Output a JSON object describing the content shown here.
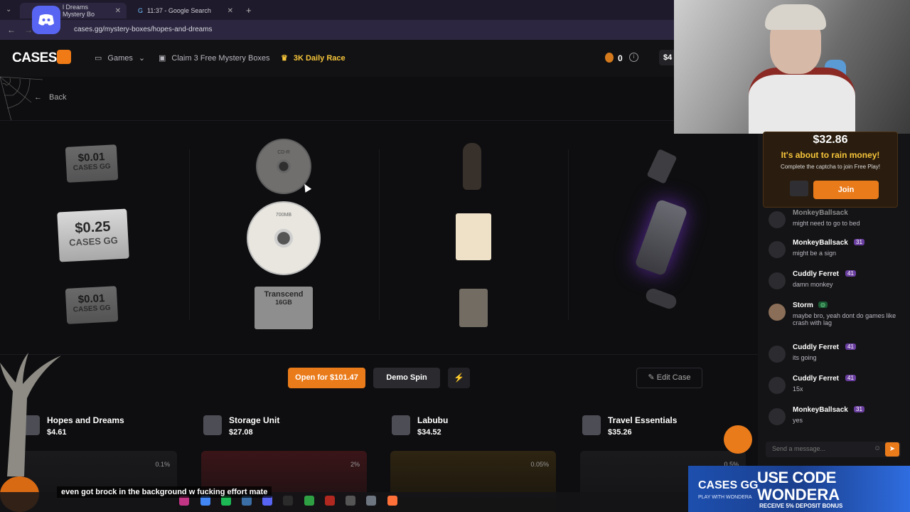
{
  "browser": {
    "tabs": [
      {
        "title": "l Dreams Mystery Bo",
        "active": true
      },
      {
        "title": "11:37 - Google Search",
        "active": false
      }
    ],
    "url": "cases.gg/mystery-boxes/hopes-and-dreams"
  },
  "nav": {
    "logo": "CASES",
    "games": "Games",
    "claim": "Claim 3 Free Mystery Boxes",
    "race": "3K Daily Race",
    "coins": "0",
    "balance": "$4",
    "back": "Back"
  },
  "reels": {
    "col1": {
      "top": "$0.01",
      "mid": "$0.25",
      "bottom": "$0.01",
      "brand": "CASES GG"
    },
    "col2": {
      "disc_label": "CD-R",
      "disc_capacity": "700MB",
      "sd_brand": "Transcend",
      "sd_capacity": "16GB"
    }
  },
  "actions": {
    "open": "Open for $101.47",
    "demo": "Demo Spin",
    "fast": "⚡",
    "edit": "Edit Case"
  },
  "contained_boxes": [
    {
      "name": "Hopes and Dreams",
      "price": "$4.61",
      "odds": "0.1%"
    },
    {
      "name": "Storage Unit",
      "price": "$27.08",
      "odds": "2%"
    },
    {
      "name": "Labubu",
      "price": "$34.52",
      "odds": "0.05%"
    },
    {
      "name": "Travel Essentials",
      "price": "$35.26",
      "odds": "0.5%"
    }
  ],
  "rain": {
    "amount": "$32.86",
    "headline": "It's about to rain money!",
    "subtext": "Complete the captcha to join Free Play!",
    "join": "Join"
  },
  "chat": {
    "messages": [
      {
        "user": "MonkeyBallsack",
        "level": "",
        "text": "might need to go to bed"
      },
      {
        "user": "MonkeyBallsack",
        "level": "31",
        "text": "might be a sign"
      },
      {
        "user": "Cuddly Ferret",
        "level": "41",
        "text": "damn monkey"
      },
      {
        "user": "Storm",
        "level": "",
        "text": "maybe bro, yeah dont do games like crash with lag"
      },
      {
        "user": "Cuddly Ferret",
        "level": "41",
        "text": "its going"
      },
      {
        "user": "Cuddly Ferret",
        "level": "41",
        "text": "15x"
      },
      {
        "user": "MonkeyBallsack",
        "level": "31",
        "text": "yes"
      }
    ],
    "placeholder": "Send a message..."
  },
  "promo": {
    "line1": "USE CODE",
    "code": "WONDERA",
    "receive": "RECEIVE 5% DEPOSIT BONUS",
    "logo": "CASES GG",
    "logo_sub": "PLAY WITH WONDERA"
  },
  "overlay": {
    "subtitle": "even got brock in the background w fucking effort mate"
  },
  "colors": {
    "accent": "#ea7b1b",
    "race": "#f7c53a",
    "level": "#6a3ea0"
  }
}
